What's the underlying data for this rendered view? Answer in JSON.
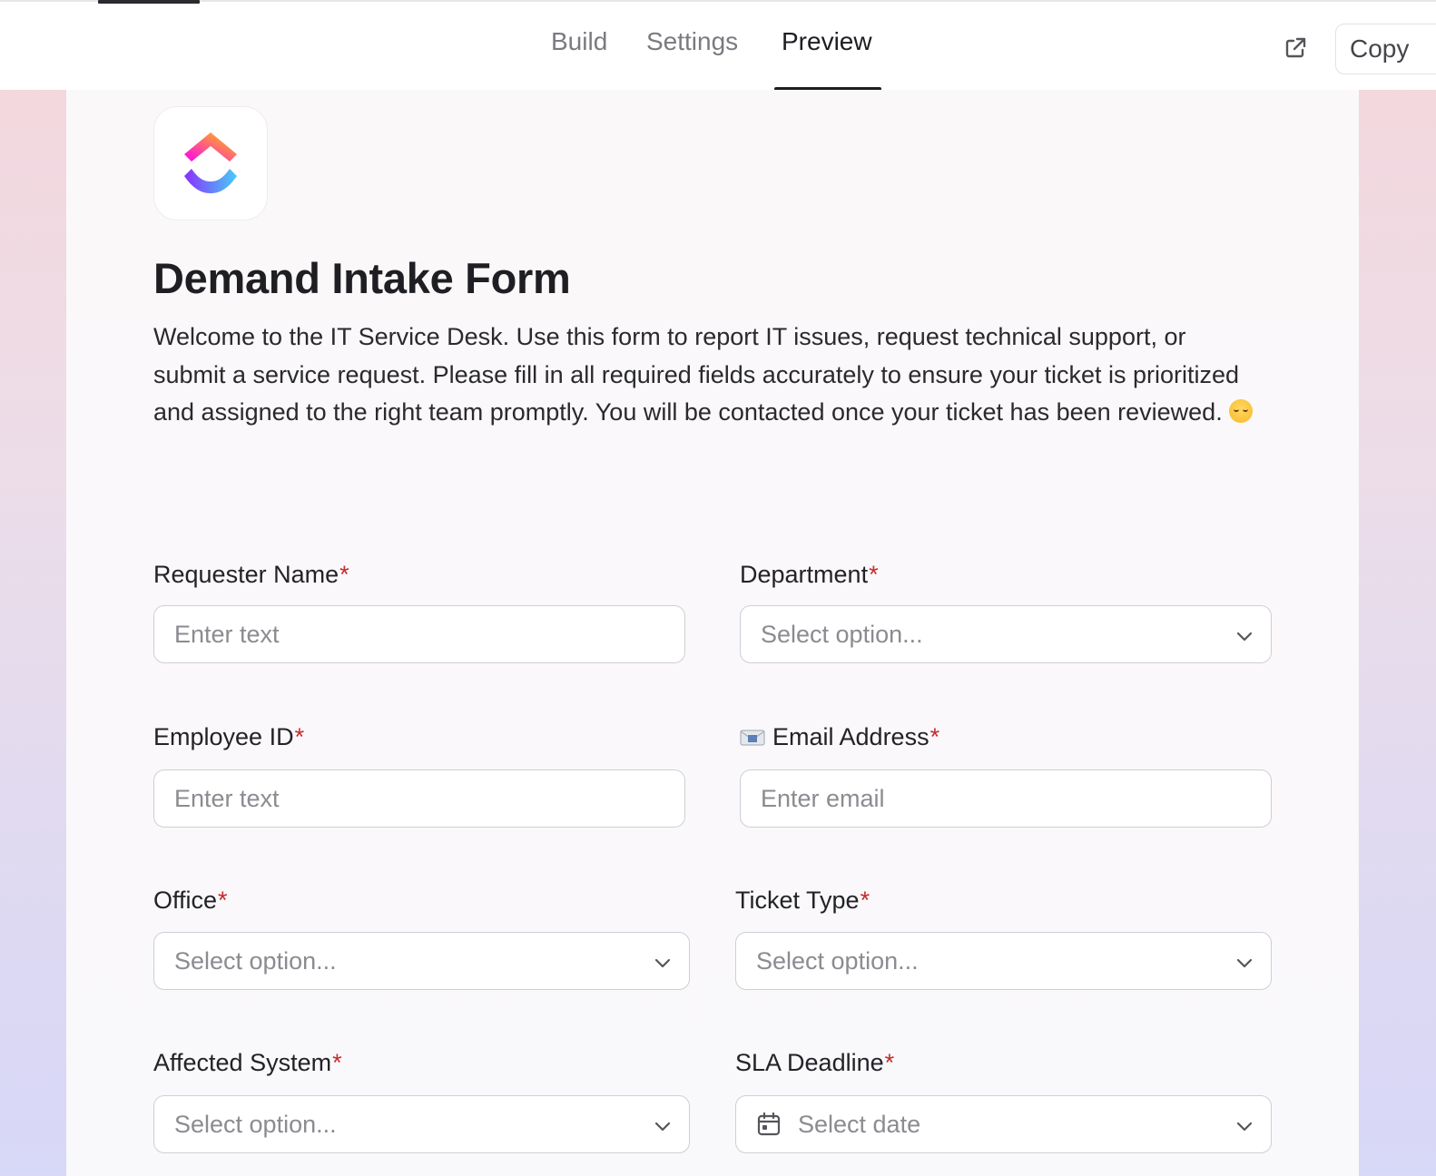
{
  "tabs": [
    {
      "label": "Build"
    },
    {
      "label": "Settings"
    },
    {
      "label": "Preview"
    }
  ],
  "active_tab": "Preview",
  "header": {
    "copy_label": "Copy",
    "open_icon": "external-link-icon"
  },
  "form": {
    "title": "Demand Intake Form",
    "description": "Welcome to the IT Service Desk. Use this form to report IT issues, request technical support, or submit a service request. Please fill in all required fields accurately to ensure your ticket is prioritized and assigned to the right team promptly. You will be contacted once your ticket has been reviewed.",
    "description_emoji": "☺️",
    "required_marker": "*",
    "fields": {
      "requester_name": {
        "label": "Requester Name",
        "placeholder": "Enter text"
      },
      "department": {
        "label": "Department",
        "placeholder": "Select option..."
      },
      "employee_id": {
        "label": "Employee ID",
        "placeholder": "Enter text"
      },
      "email_address": {
        "label": "Email Address",
        "placeholder": "Enter email",
        "icon": "envelope-icon"
      },
      "office": {
        "label": "Office",
        "placeholder": "Select option..."
      },
      "ticket_type": {
        "label": "Ticket Type",
        "placeholder": "Select option..."
      },
      "affected_system": {
        "label": "Affected System",
        "placeholder": "Select option..."
      },
      "sla_deadline": {
        "label": "SLA Deadline",
        "placeholder": "Select date",
        "icon": "calendar-icon"
      }
    }
  },
  "colors": {
    "required": "#c52b2b",
    "accent_dark": "#1e1e22"
  }
}
